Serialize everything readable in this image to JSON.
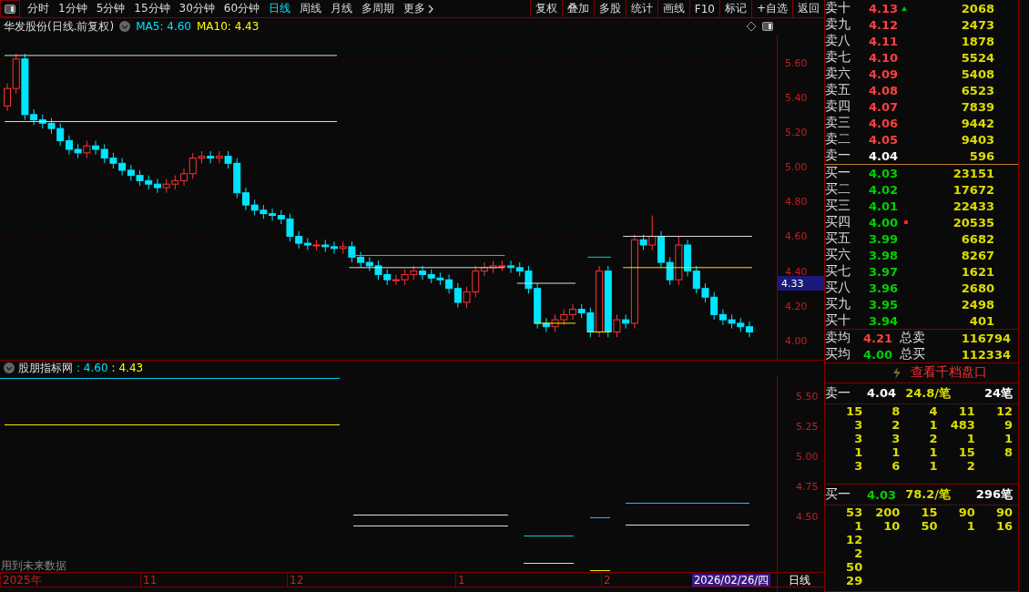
{
  "toolbar": {
    "periods": [
      {
        "label": "分时",
        "selected": false
      },
      {
        "label": "1分钟",
        "selected": false
      },
      {
        "label": "5分钟",
        "selected": false
      },
      {
        "label": "15分钟",
        "selected": false
      },
      {
        "label": "30分钟",
        "selected": false
      },
      {
        "label": "60分钟",
        "selected": false
      },
      {
        "label": "日线",
        "selected": true
      },
      {
        "label": "周线",
        "selected": false
      },
      {
        "label": "月线",
        "selected": false
      },
      {
        "label": "多周期",
        "selected": false
      },
      {
        "label": "更多",
        "selected": false
      }
    ],
    "actions": [
      "复权",
      "叠加",
      "多股",
      "统计",
      "画线",
      "F10",
      "标记",
      "+自选",
      "返回"
    ]
  },
  "chart": {
    "title": "华发股份(日线.前复权)",
    "ma": [
      {
        "label": "MA5: 4.60",
        "color": "#00e5ff"
      },
      {
        "label": "MA10: 4.43",
        "color": "#ffff00"
      }
    ],
    "chart_data": {
      "type": "candlestick",
      "grid": true,
      "ohlc": [
        [
          5.35,
          5.48,
          5.32,
          5.45
        ],
        [
          5.45,
          5.65,
          5.42,
          5.62
        ],
        [
          5.62,
          5.65,
          5.27,
          5.3
        ],
        [
          5.3,
          5.33,
          5.24,
          5.27
        ],
        [
          5.27,
          5.3,
          5.22,
          5.25
        ],
        [
          5.25,
          5.28,
          5.19,
          5.22
        ],
        [
          5.22,
          5.25,
          5.12,
          5.15
        ],
        [
          5.15,
          5.18,
          5.07,
          5.1
        ],
        [
          5.1,
          5.13,
          5.05,
          5.08
        ],
        [
          5.08,
          5.15,
          5.05,
          5.12
        ],
        [
          5.12,
          5.15,
          5.07,
          5.1
        ],
        [
          5.1,
          5.13,
          5.02,
          5.05
        ],
        [
          5.05,
          5.08,
          4.99,
          5.02
        ],
        [
          5.02,
          5.05,
          4.95,
          4.98
        ],
        [
          4.98,
          5.01,
          4.92,
          4.95
        ],
        [
          4.95,
          4.98,
          4.89,
          4.92
        ],
        [
          4.92,
          4.95,
          4.87,
          4.9
        ],
        [
          4.9,
          4.93,
          4.85,
          4.88
        ],
        [
          4.88,
          4.93,
          4.85,
          4.9
        ],
        [
          4.9,
          4.95,
          4.87,
          4.92
        ],
        [
          4.92,
          4.99,
          4.89,
          4.96
        ],
        [
          4.96,
          5.08,
          4.93,
          5.05
        ],
        [
          5.05,
          5.09,
          5.02,
          5.06
        ],
        [
          5.06,
          5.09,
          5.02,
          5.05
        ],
        [
          5.05,
          5.09,
          5.02,
          5.06
        ],
        [
          5.06,
          5.09,
          4.99,
          5.02
        ],
        [
          5.02,
          5.05,
          4.82,
          4.85
        ],
        [
          4.85,
          4.88,
          4.75,
          4.78
        ],
        [
          4.78,
          4.81,
          4.72,
          4.75
        ],
        [
          4.75,
          4.78,
          4.7,
          4.73
        ],
        [
          4.73,
          4.76,
          4.69,
          4.72
        ],
        [
          4.72,
          4.75,
          4.67,
          4.7
        ],
        [
          4.7,
          4.73,
          4.57,
          4.6
        ],
        [
          4.6,
          4.63,
          4.53,
          4.56
        ],
        [
          4.56,
          4.59,
          4.52,
          4.55
        ],
        [
          4.55,
          4.58,
          4.52,
          4.55
        ],
        [
          4.55,
          4.58,
          4.51,
          4.54
        ],
        [
          4.54,
          4.57,
          4.5,
          4.53
        ],
        [
          4.53,
          4.57,
          4.5,
          4.54
        ],
        [
          4.54,
          4.57,
          4.45,
          4.48
        ],
        [
          4.48,
          4.51,
          4.42,
          4.45
        ],
        [
          4.45,
          4.48,
          4.4,
          4.43
        ],
        [
          4.43,
          4.46,
          4.35,
          4.38
        ],
        [
          4.38,
          4.41,
          4.32,
          4.35
        ],
        [
          4.35,
          4.38,
          4.32,
          4.35
        ],
        [
          4.35,
          4.41,
          4.32,
          4.38
        ],
        [
          4.38,
          4.43,
          4.35,
          4.4
        ],
        [
          4.4,
          4.43,
          4.35,
          4.38
        ],
        [
          4.38,
          4.41,
          4.33,
          4.36
        ],
        [
          4.36,
          4.39,
          4.32,
          4.35
        ],
        [
          4.35,
          4.38,
          4.27,
          4.3
        ],
        [
          4.3,
          4.33,
          4.19,
          4.22
        ],
        [
          4.22,
          4.31,
          4.19,
          4.28
        ],
        [
          4.28,
          4.43,
          4.25,
          4.4
        ],
        [
          4.4,
          4.45,
          4.37,
          4.42
        ],
        [
          4.42,
          4.46,
          4.39,
          4.43
        ],
        [
          4.43,
          4.46,
          4.4,
          4.43
        ],
        [
          4.43,
          4.46,
          4.39,
          4.42
        ],
        [
          4.42,
          4.45,
          4.37,
          4.4
        ],
        [
          4.4,
          4.43,
          4.27,
          4.3
        ],
        [
          4.3,
          4.33,
          4.07,
          4.1
        ],
        [
          4.1,
          4.13,
          4.05,
          4.08
        ],
        [
          4.08,
          4.15,
          4.05,
          4.12
        ],
        [
          4.12,
          4.18,
          4.09,
          4.15
        ],
        [
          4.15,
          4.21,
          4.12,
          4.18
        ],
        [
          4.18,
          4.21,
          4.13,
          4.16
        ],
        [
          4.16,
          4.19,
          4.02,
          4.05
        ],
        [
          4.05,
          4.43,
          4.02,
          4.4
        ],
        [
          4.4,
          4.43,
          4.02,
          4.05
        ],
        [
          4.05,
          4.15,
          4.02,
          4.12
        ],
        [
          4.12,
          4.15,
          4.07,
          4.1
        ],
        [
          4.1,
          4.61,
          4.07,
          4.58
        ],
        [
          4.58,
          4.61,
          4.52,
          4.55
        ],
        [
          4.55,
          4.72,
          4.52,
          4.6
        ],
        [
          4.6,
          4.63,
          4.42,
          4.45
        ],
        [
          4.45,
          4.48,
          4.32,
          4.35
        ],
        [
          4.35,
          4.6,
          4.32,
          4.55
        ],
        [
          4.55,
          4.58,
          4.37,
          4.4
        ],
        [
          4.4,
          4.43,
          4.27,
          4.3
        ],
        [
          4.3,
          4.33,
          4.22,
          4.25
        ],
        [
          4.25,
          4.28,
          4.12,
          4.15
        ],
        [
          4.15,
          4.18,
          4.09,
          4.12
        ],
        [
          4.12,
          4.15,
          4.07,
          4.1
        ],
        [
          4.1,
          4.13,
          4.05,
          4.08
        ],
        [
          4.08,
          4.11,
          4.02,
          4.05
        ]
      ],
      "ylim": [
        3.89,
        5.76
      ],
      "yticks": [
        {
          "value": 5.6,
          "label": "5.60"
        },
        {
          "value": 5.4,
          "label": "5.40"
        },
        {
          "value": 5.2,
          "label": "5.20"
        },
        {
          "value": 5.0,
          "label": "5.00"
        },
        {
          "value": 4.8,
          "label": "4.80"
        },
        {
          "value": 4.6,
          "label": "4.60"
        },
        {
          "value": 4.4,
          "label": "4.40"
        },
        {
          "value": 4.2,
          "label": "4.20"
        },
        {
          "value": 4.0,
          "label": "4.00"
        }
      ]
    },
    "current_price": "4.33"
  },
  "indicator": {
    "name": "股朋指标网",
    "values": [
      {
        "text": ": 4.60",
        "color": "#00e5ff"
      },
      {
        "text": ": 4.43",
        "color": "#ffff00"
      }
    ],
    "ticks": [
      "5.50",
      "5.25",
      "5.00",
      "4.75",
      "4.50"
    ],
    "note": "用到未来数据"
  },
  "time_axis": {
    "labels": [
      "2025年",
      "11",
      "12",
      "1",
      "2"
    ],
    "cursor_date": "2026/02/26/四",
    "period": "日线"
  },
  "order_book": {
    "asks": [
      {
        "label": "卖十",
        "price": "4.13",
        "volume": "2068",
        "color": "#ff4040",
        "arrow": true,
        "flag": false
      },
      {
        "label": "卖九",
        "price": "4.12",
        "volume": "2473",
        "color": "#ff4040",
        "arrow": false,
        "flag": false
      },
      {
        "label": "卖八",
        "price": "4.11",
        "volume": "1878",
        "color": "#ff4040",
        "arrow": false,
        "flag": false
      },
      {
        "label": "卖七",
        "price": "4.10",
        "volume": "5524",
        "color": "#ff4040",
        "arrow": false,
        "flag": false
      },
      {
        "label": "卖六",
        "price": "4.09",
        "volume": "5408",
        "color": "#ff4040",
        "arrow": false,
        "flag": false
      },
      {
        "label": "卖五",
        "price": "4.08",
        "volume": "6523",
        "color": "#ff4040",
        "arrow": false,
        "flag": false
      },
      {
        "label": "卖四",
        "price": "4.07",
        "volume": "7839",
        "color": "#ff4040",
        "arrow": false,
        "flag": false
      },
      {
        "label": "卖三",
        "price": "4.06",
        "volume": "9442",
        "color": "#ff4040",
        "arrow": false,
        "flag": false
      },
      {
        "label": "卖二",
        "price": "4.05",
        "volume": "9403",
        "color": "#ff4040",
        "arrow": false,
        "flag": false
      },
      {
        "label": "卖一",
        "price": "4.04",
        "volume": "596",
        "color": "#ffffff",
        "arrow": false,
        "flag": false
      }
    ],
    "bids": [
      {
        "label": "买一",
        "price": "4.03",
        "volume": "23151",
        "color": "#00d000",
        "arrow": false,
        "flag": false
      },
      {
        "label": "买二",
        "price": "4.02",
        "volume": "17672",
        "color": "#00d000",
        "arrow": false,
        "flag": false
      },
      {
        "label": "买三",
        "price": "4.01",
        "volume": "22433",
        "color": "#00d000",
        "arrow": false,
        "flag": false
      },
      {
        "label": "买四",
        "price": "4.00",
        "volume": "20535",
        "color": "#00d000",
        "arrow": false,
        "flag": true
      },
      {
        "label": "买五",
        "price": "3.99",
        "volume": "6682",
        "color": "#00d000",
        "arrow": false,
        "flag": false
      },
      {
        "label": "买六",
        "price": "3.98",
        "volume": "8267",
        "color": "#00d000",
        "arrow": false,
        "flag": false
      },
      {
        "label": "买七",
        "price": "3.97",
        "volume": "1621",
        "color": "#00d000",
        "arrow": false,
        "flag": false
      },
      {
        "label": "买八",
        "price": "3.96",
        "volume": "2680",
        "color": "#00d000",
        "arrow": false,
        "flag": false
      },
      {
        "label": "买九",
        "price": "3.95",
        "volume": "2498",
        "color": "#00d000",
        "arrow": false,
        "flag": false
      },
      {
        "label": "买十",
        "price": "3.94",
        "volume": "401",
        "color": "#00d000",
        "arrow": false,
        "flag": false
      }
    ],
    "summary": [
      {
        "label": "卖均",
        "price": "4.21",
        "color": "#ff4040",
        "total_label": "总卖",
        "total": "116794"
      },
      {
        "label": "买均",
        "price": "4.00",
        "color": "#00d000",
        "total_label": "总买",
        "total": "112334"
      }
    ],
    "depth_link": "查看千档盘口",
    "tick_blocks": [
      {
        "label": "卖一",
        "price": "4.04",
        "color": "#ffffff",
        "avg": "24.8/笔",
        "count": "24笔",
        "rows": [
          [
            "15",
            "8",
            "4",
            "11",
            "12"
          ],
          [
            "3",
            "2",
            "1",
            "483",
            "9"
          ],
          [
            "3",
            "3",
            "2",
            "1",
            "1"
          ],
          [
            "1",
            "1",
            "1",
            "15",
            "8"
          ],
          [
            "3",
            "6",
            "1",
            "2"
          ]
        ]
      },
      {
        "label": "买一",
        "price": "4.03",
        "color": "#00d000",
        "avg": "78.2/笔",
        "count": "296笔",
        "rows": [
          [
            "53",
            "200",
            "15",
            "90",
            "90"
          ],
          [
            "1",
            "10",
            "50",
            "1",
            "16"
          ],
          [
            "12"
          ],
          [
            "2"
          ],
          [
            "50"
          ],
          [
            "29"
          ]
        ]
      }
    ]
  }
}
